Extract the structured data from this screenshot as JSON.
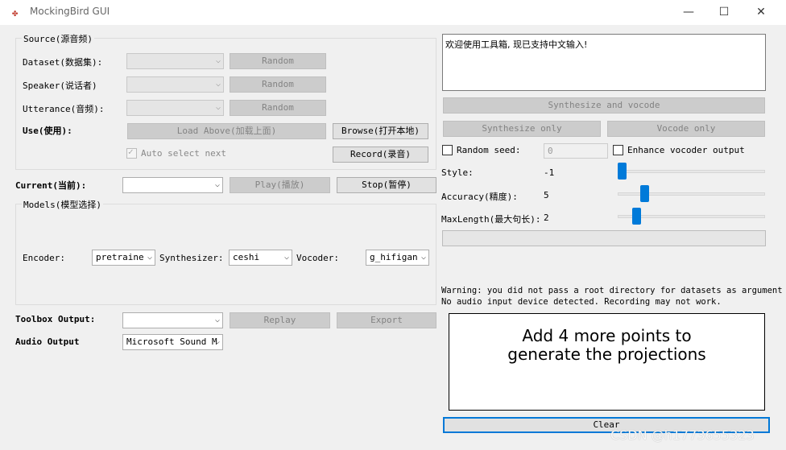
{
  "window": {
    "title": "MockingBird GUI",
    "minimize": "—",
    "maximize": "☐",
    "close": "✕"
  },
  "source": {
    "group_title": "Source(源音频)",
    "dataset_label": "Dataset(数据集):",
    "speaker_label": "Speaker(说话者)",
    "utterance_label": "Utterance(音频):",
    "random_label": "Random",
    "use_label": "Use(使用):",
    "load_above": "Load Above(加载上面)",
    "browse": "Browse(打开本地)",
    "auto_select": "Auto select next",
    "record": "Record(录音)"
  },
  "current": {
    "label": "Current(当前):",
    "play": "Play(播放)",
    "stop": "Stop(暂停)"
  },
  "models": {
    "group_title": "Models(模型选择)",
    "encoder_label": "Encoder:",
    "encoder_value": "pretraine",
    "synthesizer_label": "Synthesizer:",
    "synthesizer_value": "ceshi",
    "vocoder_label": "Vocoder:",
    "vocoder_value": "g_hifigan"
  },
  "output": {
    "toolbox_label": "Toolbox Output:",
    "replay": "Replay",
    "export": "Export",
    "audio_label": "Audio Output",
    "audio_value": "Microsoft Sound M"
  },
  "right": {
    "text_input": "欢迎使用工具箱, 现已支持中文输入!",
    "synthesize_vocode": "Synthesize and vocode",
    "synthesize_only": "Synthesize only",
    "vocode_only": "Vocode only",
    "random_seed_label": "Random seed:",
    "random_seed_value": "0",
    "enhance_label": "Enhance vocoder output",
    "style_label": "Style:",
    "style_value": "-1",
    "accuracy_label": "Accuracy(精度):",
    "accuracy_value": "5",
    "maxlength_label": "MaxLength(最大句长):",
    "maxlength_value": "2",
    "warning_line1": "Warning: you did not pass a root directory for datasets as argument",
    "warning_line2": "No audio input device detected. Recording may not work.",
    "plot_message_line1": "Add 4 more points to",
    "plot_message_line2": "generate the projections",
    "clear": "Clear"
  },
  "watermark": "CSDN @h1773655323",
  "icons": {
    "app": "bird-icon",
    "dropdown": "chevron-down-icon"
  },
  "colors": {
    "slider_thumb": "#007ad9",
    "clear_border": "#0078d7",
    "window_bg": "#f0f0f0"
  }
}
